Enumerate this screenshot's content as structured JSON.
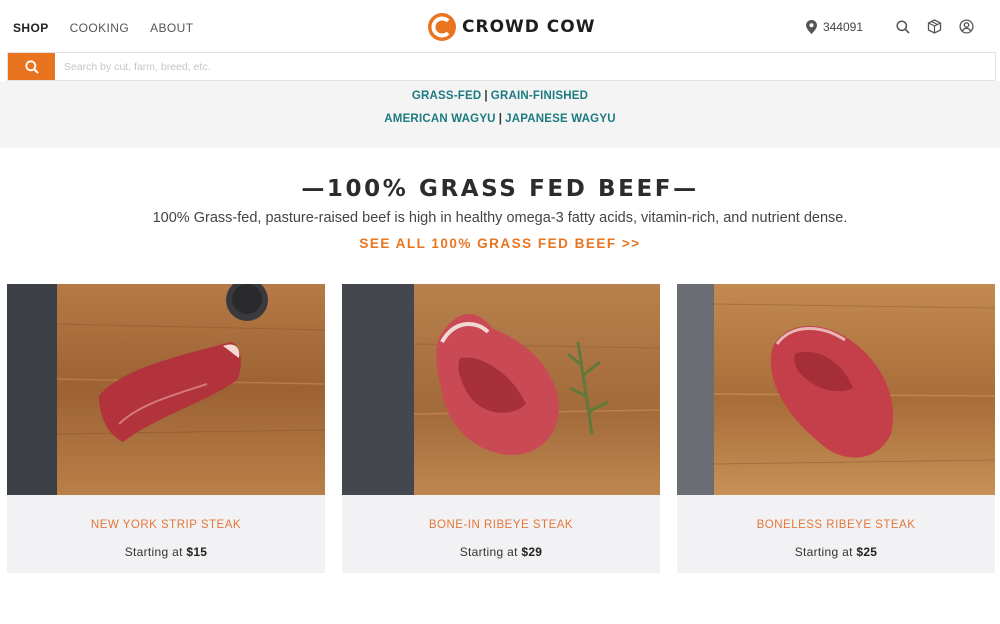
{
  "nav": {
    "items": [
      {
        "label": "SHOP"
      },
      {
        "label": "COOKING"
      },
      {
        "label": "ABOUT"
      }
    ]
  },
  "brand": {
    "name": "CROWD COW",
    "accent_color": "#e8741f"
  },
  "header_tools": {
    "zip_code": "344091",
    "icons": [
      "location-pin-icon",
      "search-icon",
      "box-icon",
      "account-icon"
    ]
  },
  "search": {
    "placeholder": "Search by cut, farm, breed, etc."
  },
  "categories": {
    "row1": [
      "GRASS-FED",
      "GRAIN-FINISHED"
    ],
    "row2": [
      "AMERICAN WAGYU",
      "JAPANESE WAGYU"
    ],
    "separator": "|",
    "link_color": "#1c7a80"
  },
  "section": {
    "title": "—100% GRASS FED BEEF—",
    "description": "100% Grass-fed, pasture-raised beef is high in healthy omega-3 fatty acids, vitamin-rich, and nutrient dense.",
    "see_all": "SEE ALL 100% GRASS FED BEEF >>"
  },
  "products": [
    {
      "name": "NEW YORK STRIP STEAK",
      "price_prefix": "Starting at",
      "price": "$15"
    },
    {
      "name": "BONE-IN RIBEYE STEAK",
      "price_prefix": "Starting at",
      "price": "$29"
    },
    {
      "name": "BONELESS RIBEYE STEAK",
      "price_prefix": "Starting at",
      "price": "$25"
    }
  ]
}
